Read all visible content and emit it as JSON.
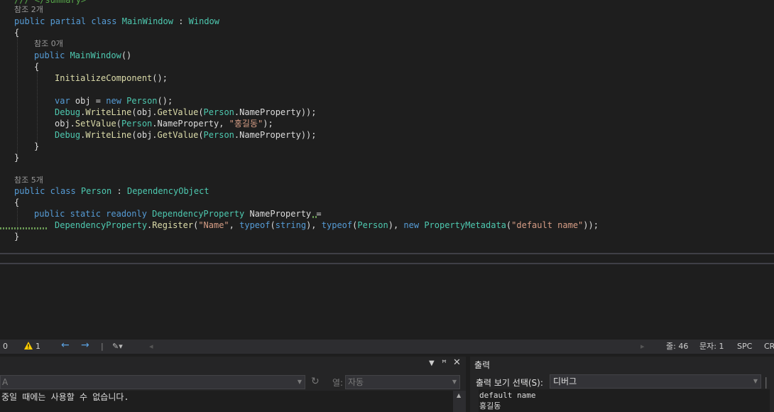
{
  "code": {
    "top_partial": "/// </summary>",
    "ref_2": "참조 2개",
    "l_class_kw": "public partial class ",
    "l_class_name": "MainWindow",
    "l_class_colon": " : ",
    "l_class_base": "Window",
    "brace_open": "{",
    "brace_close": "}",
    "ref_0": "참조 0개",
    "ctor_kw": "public ",
    "ctor_name": "MainWindow",
    "ctor_parens": "()",
    "init_call": "InitializeComponent",
    "init_tail": "();",
    "var_kw": "var ",
    "var_mid": "obj = ",
    "new_kw": "new ",
    "person": "Person",
    "new_tail": "();",
    "debug": "Debug",
    "dot": ".",
    "writeline": "WriteLine",
    "open_obj": "(obj.",
    "getvalue": "GetValue",
    "open_paren": "(",
    "name_prop_tail": ".NameProperty));",
    "setvalue_head": "obj.",
    "setvalue": "SetValue",
    "name_prop_comma": ".NameProperty, ",
    "hong": "\"홍길동\"",
    "set_tail": ");",
    "ref_5": "참조 5개",
    "p_class_kw": "public class ",
    "p_class_name": "Person",
    "p_colon": " : ",
    "p_base": "DependencyObject",
    "field_kw": "public static readonly ",
    "field_type": "DependencyProperty",
    "field_name": " NameProperty =",
    "reg_type": "DependencyProperty",
    "register": "Register",
    "str_name": "\"Name\"",
    "comma": ", ",
    "typeof_kw": "typeof",
    "string_kw": "string",
    "close_comma": "), ",
    "new2_kw": "new ",
    "pmeta": "PropertyMetadata",
    "str_default": "\"default name\"",
    "reg_tail": "));"
  },
  "status_bar": {
    "errors": "0",
    "warnings": "1",
    "line_label": "줄: 46",
    "char_label": "문자: 1",
    "spc": "SPC",
    "crlf": "CR"
  },
  "left_panel": {
    "dropdown1_value": "A",
    "col_label": "열:",
    "col_value": "자동",
    "message": "중일 때에는 사용할 수 없습니다."
  },
  "output_panel": {
    "title": "출력",
    "source_label": "출력 보기 선택(S):",
    "source_value": "디버그",
    "lines": [
      "default name",
      "홍길동"
    ]
  },
  "colors": {
    "keyword": "#569cd6",
    "type": "#4ec9b0",
    "method": "#dcdcaa",
    "string": "#d69d85"
  }
}
